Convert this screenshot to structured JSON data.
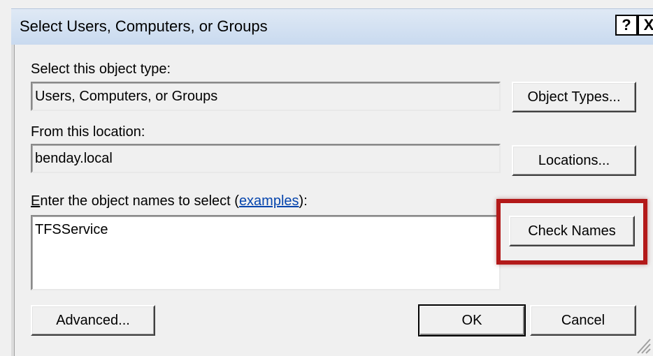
{
  "window": {
    "title": "Select Users, Computers, or Groups",
    "help_label": "?",
    "close_label": "X"
  },
  "object_type": {
    "label": "Select this object type:",
    "value": "Users, Computers, or Groups",
    "button": "Object Types..."
  },
  "location": {
    "label": "From this location:",
    "value": "benday.local",
    "button": "Locations..."
  },
  "names": {
    "label_accel": "E",
    "label_rest": "nter the object names to select (",
    "link": "examples",
    "label_end": "):",
    "value": "TFSService",
    "check_button": "Check Names"
  },
  "footer": {
    "advanced": "Advanced...",
    "ok": "OK",
    "cancel": "Cancel"
  },
  "colors": {
    "highlight": "#b31919",
    "link": "#0645ad"
  }
}
